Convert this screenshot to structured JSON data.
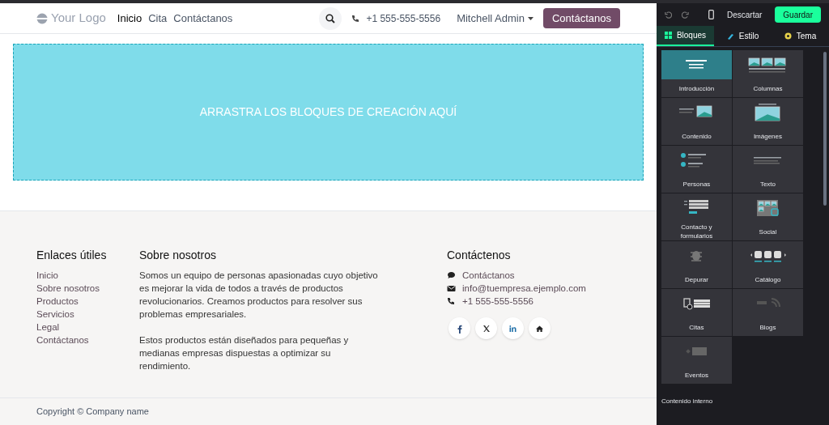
{
  "header": {
    "logo": "Your Logo",
    "nav": [
      {
        "label": "Inicio",
        "selected": true
      },
      {
        "label": "Cita",
        "selected": false
      },
      {
        "label": "Contáctanos",
        "selected": false
      }
    ],
    "phone": "+1 555-555-5556",
    "user": "Mitchell Admin",
    "cta": "Contáctanos"
  },
  "dropzone": {
    "text": "ARRASTRA LOS BLOQUES DE CREACIÓN AQUÍ"
  },
  "footer": {
    "links_title": "Enlaces útiles",
    "links": [
      "Inicio",
      "Sobre nosotros",
      "Productos",
      "Servicios",
      "Legal",
      "Contáctanos"
    ],
    "about_title": "Sobre nosotros",
    "about": [
      "Somos un equipo de personas apasionadas cuyo objetivo es mejorar la vida de todos a través de productos revolucionarios. Creamos productos para resolver sus problemas empresariales.",
      "Estos productos están diseñados para pequeñas y medianas empresas dispuestas a optimizar su rendimiento."
    ],
    "contact_title": "Contáctenos",
    "contacts": [
      {
        "kind": "chat",
        "text": "Contáctanos"
      },
      {
        "kind": "mail",
        "text": "info@tuempresa.ejemplo.com"
      },
      {
        "kind": "phone",
        "text": "+1 555-555-5556"
      }
    ],
    "social": [
      {
        "kind": "facebook"
      },
      {
        "kind": "x"
      },
      {
        "kind": "linkedin"
      },
      {
        "kind": "home"
      }
    ]
  },
  "copyright": "Copyright © Company name",
  "editor": {
    "discard": "Descartar",
    "save": "Guardar",
    "tabs": [
      {
        "label": "Bloques",
        "kind": "blocks",
        "selected": true
      },
      {
        "label": "Estilo",
        "kind": "style",
        "selected": false
      },
      {
        "label": "Tema",
        "kind": "theme",
        "selected": false
      }
    ],
    "blocks": [
      {
        "label": "Introducción",
        "kind": "intro",
        "selected": true
      },
      {
        "label": "Columnas",
        "kind": "columns",
        "selected": false
      },
      {
        "label": "Contenido",
        "kind": "content",
        "selected": false
      },
      {
        "label": "Imágenes",
        "kind": "images",
        "selected": false
      },
      {
        "label": "Personas",
        "kind": "people",
        "selected": false
      },
      {
        "label": "Texto",
        "kind": "text",
        "selected": false
      },
      {
        "label": "Contacto y formularios",
        "kind": "form",
        "selected": false
      },
      {
        "label": "Social",
        "kind": "social",
        "selected": false
      },
      {
        "label": "Depurar",
        "kind": "bug",
        "selected": false
      },
      {
        "label": "Catálogo",
        "kind": "catalog",
        "selected": false
      },
      {
        "label": "Citas",
        "kind": "appointments",
        "selected": false
      },
      {
        "label": "Blogs",
        "kind": "blog",
        "selected": false
      },
      {
        "label": "Eventos",
        "kind": "events",
        "selected": false
      }
    ],
    "section_title": "Contenido interno"
  }
}
